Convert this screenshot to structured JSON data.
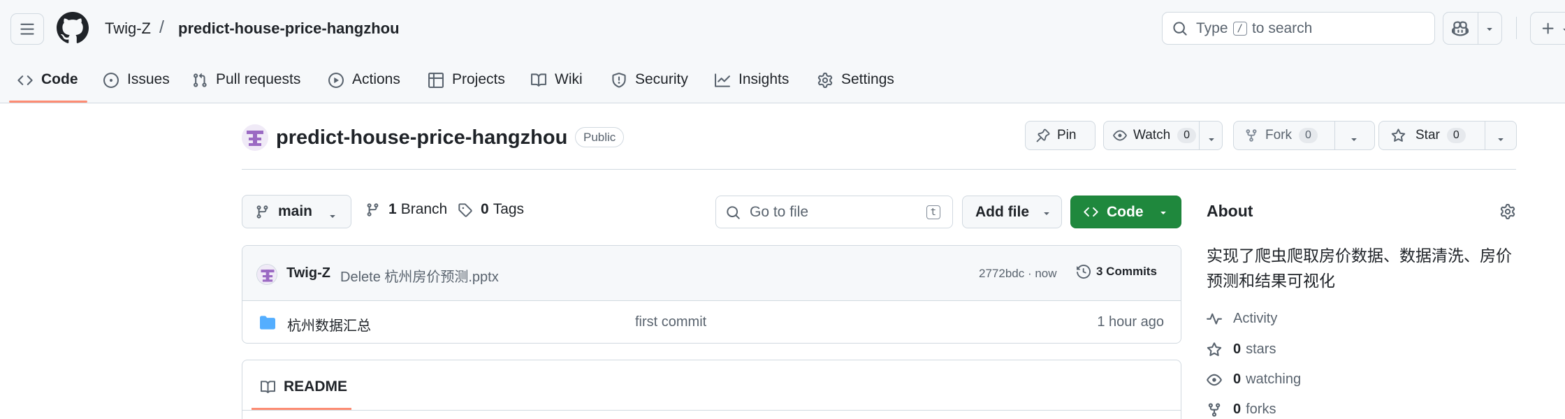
{
  "header": {
    "owner": "Twig-Z",
    "separator": "/",
    "repo": "predict-house-price-hangzhou",
    "search": {
      "prefix": "Type",
      "key": "/",
      "suffix": "to search"
    }
  },
  "tabs": [
    {
      "label": "Code",
      "icon": "code-icon"
    },
    {
      "label": "Issues",
      "icon": "issue-icon"
    },
    {
      "label": "Pull requests",
      "icon": "pull-request-icon"
    },
    {
      "label": "Actions",
      "icon": "play-icon"
    },
    {
      "label": "Projects",
      "icon": "table-icon"
    },
    {
      "label": "Wiki",
      "icon": "book-icon"
    },
    {
      "label": "Security",
      "icon": "shield-icon"
    },
    {
      "label": "Insights",
      "icon": "graph-icon"
    },
    {
      "label": "Settings",
      "icon": "gear-icon"
    }
  ],
  "repo_header": {
    "title": "predict-house-price-hangzhou",
    "visibility": "Public",
    "pin": "Pin",
    "watch": {
      "label": "Watch",
      "count": "0"
    },
    "fork": {
      "label": "Fork",
      "count": "0"
    },
    "star": {
      "label": "Star",
      "count": "0"
    }
  },
  "file_nav": {
    "branch": "main",
    "branches": {
      "count": "1",
      "label": "Branch"
    },
    "tags": {
      "count": "0",
      "label": "Tags"
    },
    "goto_placeholder": "Go to file",
    "goto_key": "t",
    "add_file": "Add file",
    "code": "Code"
  },
  "latest_commit": {
    "author": "Twig-Z",
    "message": "Delete 杭州房价预测.pptx",
    "meta": "2772bdc · now",
    "commits": "3 Commits"
  },
  "files": [
    {
      "name": "杭州数据汇总",
      "message": "first commit",
      "time": "1 hour ago",
      "type": "folder"
    }
  ],
  "readme": {
    "label": "README"
  },
  "about": {
    "title": "About",
    "description": "实现了爬虫爬取房价数据、数据清洗、房价预测和结果可视化",
    "activity": "Activity",
    "stars": {
      "count": "0",
      "label": "stars"
    },
    "watching": {
      "count": "0",
      "label": "watching"
    },
    "forks": {
      "count": "0",
      "label": "forks"
    }
  },
  "colors": {
    "accent_underline": "#fd8c73",
    "primary_button": "#1f883d",
    "folder": "#54aeff",
    "border": "#d1d9e0"
  }
}
